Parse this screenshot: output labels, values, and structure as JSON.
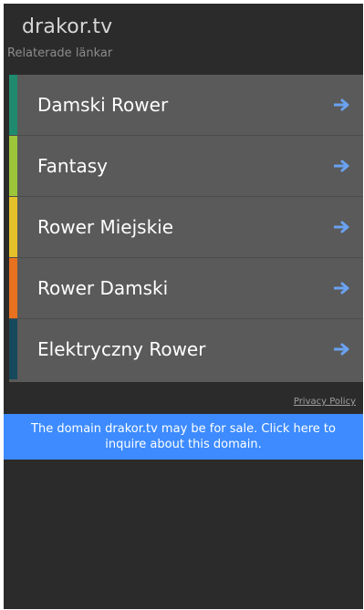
{
  "header": {
    "site_title": "drakor.tv",
    "related_label": "Relaterade länkar"
  },
  "links": [
    {
      "label": "Damski Rower",
      "color": "#1f8a6e",
      "icon": "arrow-right-icon"
    },
    {
      "label": "Fantasy",
      "color": "#9cc53a",
      "icon": "arrow-right-icon"
    },
    {
      "label": "Rower Miejskie",
      "color": "#e4c12a",
      "icon": "arrow-right-icon"
    },
    {
      "label": "Rower Damski",
      "color": "#e8711f",
      "icon": "arrow-right-icon"
    },
    {
      "label": "Elektryczny Rower",
      "color": "#16495c",
      "icon": "arrow-right-icon"
    }
  ],
  "footer": {
    "privacy_label": "Privacy Policy"
  },
  "banner": {
    "text": "The domain drakor.tv may be for sale. Click here to inquire about this domain.",
    "color": "#3d8bff"
  },
  "colors": {
    "background": "#2b2b2b",
    "list_background": "#5a5a5a",
    "arrow": "#6aa2f0"
  }
}
